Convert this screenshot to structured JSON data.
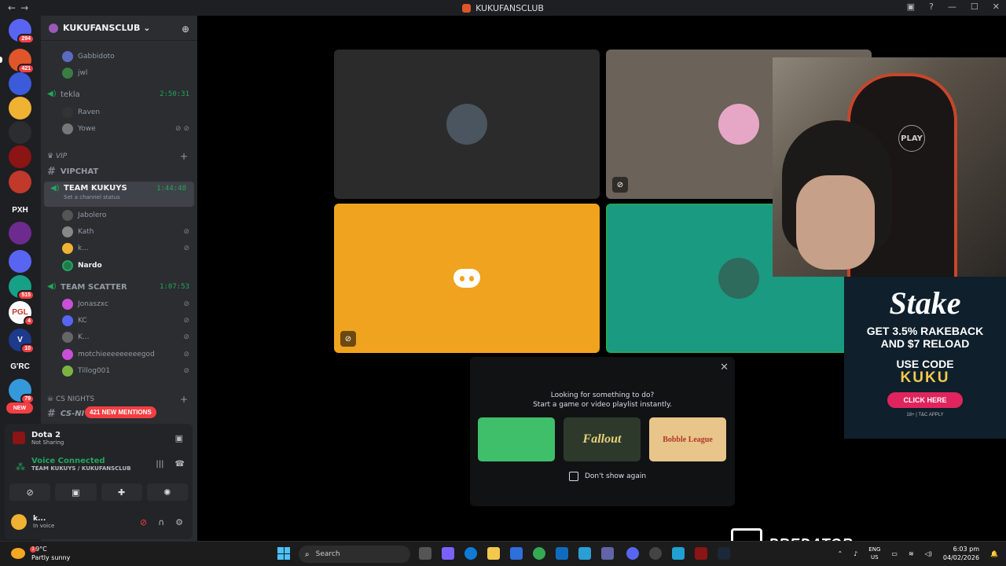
{
  "window": {
    "title": "KUKUFANSCLUB",
    "back": "←",
    "forward": "→"
  },
  "servers": [
    {
      "label": "",
      "badge": "294",
      "color": "#5865f2"
    },
    {
      "label": "",
      "badge": "421",
      "color": "#e0552a"
    },
    {
      "label": "",
      "badge": "",
      "color": "#3b5bdb"
    },
    {
      "label": "",
      "badge": "",
      "color": "#f0b232"
    },
    {
      "label": "",
      "badge": "",
      "color": "#2b2d31"
    },
    {
      "label": "",
      "badge": "",
      "color": "#8b1414"
    },
    {
      "label": "",
      "badge": "",
      "color": "#c0392b"
    },
    {
      "label": "PXH",
      "badge": "",
      "color": "#1e1f22"
    },
    {
      "label": "",
      "badge": "",
      "color": "#6d2b8f"
    },
    {
      "label": "",
      "badge": "",
      "color": "#5865f2"
    },
    {
      "label": "",
      "badge": "515",
      "color": "#16a085"
    },
    {
      "label": "PGL",
      "badge": "4",
      "color": "#ffffff"
    },
    {
      "label": "V",
      "badge": "10",
      "color": "#1e3a8a"
    },
    {
      "label": "G'RC",
      "badge": "",
      "color": "#1e1f22"
    },
    {
      "label": "",
      "badge": "79",
      "color": "#3498db"
    },
    {
      "label": "NEW",
      "badge": "",
      "color": "#f23f43"
    }
  ],
  "server_header": {
    "name": "KUKUFANSCLUB",
    "chevron": "⌄"
  },
  "channels": {
    "top_users": [
      {
        "name": "Gabbidoto",
        "color": "#5c6bc0"
      },
      {
        "name": "jwl",
        "color": "#3a7d44"
      }
    ],
    "tekla": {
      "name": "tekla",
      "timer": "2:50:31"
    },
    "tekla_users": [
      {
        "name": "Raven",
        "color": "#333",
        "icons": ""
      },
      {
        "name": "Yowe",
        "color": "#777",
        "icons": "⊘ ⊘"
      }
    ],
    "vip_category": {
      "name": "VIP",
      "plus": "+"
    },
    "vipchat": {
      "name": "VIPCHAT"
    },
    "team_kukuys": {
      "name": "TEAM KUKUYS",
      "timer": "1:44:48",
      "status": "Set a channel status"
    },
    "team_kukuys_users": [
      {
        "name": "Jabolero",
        "color": "#555",
        "icons": ""
      },
      {
        "name": "Kath",
        "color": "#888",
        "icons": "⊘"
      },
      {
        "name": "k...",
        "color": "#f0b232",
        "icons": "⊘"
      },
      {
        "name": "Nardo",
        "color": "#1f7a4d",
        "icons": ""
      }
    ],
    "team_scatter": {
      "name": "TEAM SCATTER",
      "timer": "1:07:53"
    },
    "team_scatter_users": [
      {
        "name": "Jonaszxc",
        "color": "#c94fd6",
        "icons": "⊘"
      },
      {
        "name": "KC",
        "color": "#5865f2",
        "icons": "⊘"
      },
      {
        "name": "K...",
        "color": "#666",
        "icons": "⊘"
      },
      {
        "name": "motchieeeeeeeeegod",
        "color": "#c94fd6",
        "icons": "⊘"
      },
      {
        "name": "Tillog001",
        "color": "#7cb342",
        "icons": "⊘"
      }
    ],
    "cs_category": {
      "name": "CS NIGHTS",
      "plus": "+"
    },
    "cs_channel": {
      "name": "CS-NI"
    }
  },
  "mentions_pill": "421 NEW MENTIONS",
  "activity_panel": {
    "game_title": "Dota 2",
    "game_status": "Not Sharing",
    "voice_status": "Voice Connected",
    "voice_channel": "TEAM KUKUYS / KUKUFANSCLUB"
  },
  "user_bar": {
    "name": "k...",
    "status": "In voice"
  },
  "video_tiles": {
    "tile1_color": "#2b2b2b",
    "tile2_color": "#6b625a",
    "tile3_color": "#f0a31f",
    "tile4_color": "#1a9a80"
  },
  "activity_prompt": {
    "close": "✕",
    "line1": "Looking for something to do?",
    "line2": "Start a game or video playlist instantly.",
    "cards": [
      {
        "label": "",
        "color": "#3fbf6a"
      },
      {
        "label": "Fallout",
        "color": "#2d3a2b"
      },
      {
        "label": "Bobble League",
        "color": "#e8c58a"
      }
    ],
    "checkbox_label": "Don't show again"
  },
  "overlay": {
    "chair_logo": "PLAY",
    "stake_logo": "Stake",
    "line1": "GET 3.5% RAKEBACK",
    "line2": "AND $7 RELOAD",
    "use_code": "USE CODE",
    "code": "KUKU",
    "button": "CLICK HERE",
    "fine": "18+ | T&C APPLY",
    "brand": "PREDATOR"
  },
  "taskbar": {
    "weather_temp": "29°C",
    "weather_desc": "Partly sunny",
    "weather_badge": "1",
    "search_placeholder": "Search",
    "lang_top": "ENG",
    "lang_bottom": "US",
    "time": "6:03 pm",
    "date": "04/02/2026"
  }
}
